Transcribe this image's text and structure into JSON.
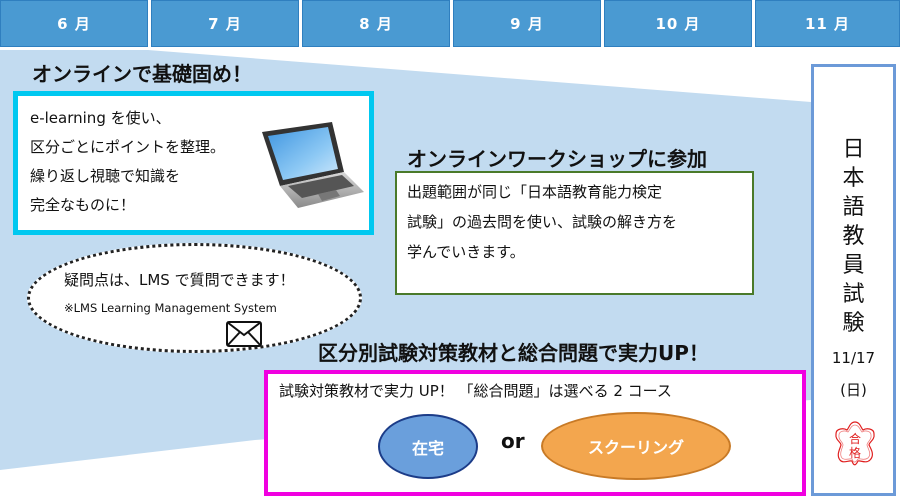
{
  "timeline": {
    "months": [
      "6 月",
      "7 月",
      "8 月",
      "9 月",
      "10 月",
      "11 月"
    ]
  },
  "section_online": {
    "title": "オンラインで基礎固め！",
    "lines": [
      "e-learning を使い、",
      "区分ごとにポイントを整理。",
      "繰り返し視聴で知識を",
      "完全なものに！"
    ],
    "icon": "laptop-icon"
  },
  "lms_bubble": {
    "question": "疑問点は、LMS で質問できます！",
    "note": "※LMS  Learning Management System",
    "icon": "envelope-icon"
  },
  "section_workshop": {
    "title": "オンラインワークショップに参加",
    "lines": [
      "出題範囲が同じ「日本語教育能力検定",
      "試験」の過去問を使い、試験の解き方を",
      "学んでいきます。"
    ]
  },
  "section_materials": {
    "title": "区分別試験対策教材と総合問題で実力UP！",
    "subtitle": "試験対策教材で実力 UP！ 「総合問題」は選べる 2 コース",
    "option_home": "在宅",
    "or_label": "or",
    "option_schooling": "スクーリング"
  },
  "exam": {
    "title_chars": [
      "日",
      "本",
      "語",
      "教",
      "員",
      "試",
      "験"
    ],
    "date": "11/17",
    "weekday": "(日)",
    "stamp_chars": [
      "合",
      "格"
    ]
  },
  "colors": {
    "month_header": "#4a9ad2",
    "background_band": "#c2dbf0",
    "online_border": "#00c8f0",
    "workshop_border": "#4a7a2a",
    "materials_border": "#f000e0",
    "exam_border": "#6c9ad8",
    "home_pill": "#6a9fdc",
    "schooling_pill": "#f3a64e",
    "stamp": "#e02020"
  }
}
